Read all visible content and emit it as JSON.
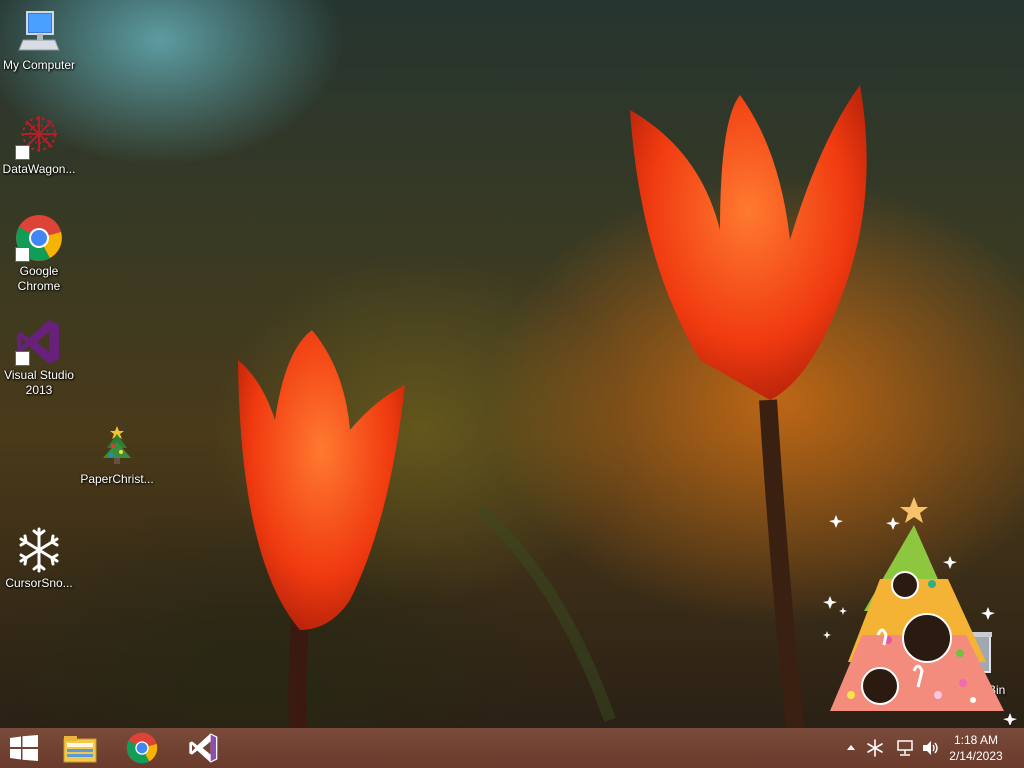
{
  "desktop": {
    "icons": [
      {
        "label": "My Computer",
        "icon": "computer-icon"
      },
      {
        "label": "DataWagon...",
        "icon": "snowflake-red-icon"
      },
      {
        "label": "Google Chrome",
        "icon": "chrome-icon"
      },
      {
        "label": "Visual Studio 2013",
        "icon": "visual-studio-icon"
      },
      {
        "label": "PaperChrist...",
        "icon": "christmas-tree-icon"
      },
      {
        "label": "CursorSno...",
        "icon": "snowflake-white-icon"
      }
    ],
    "recycle_bin_label": "Bin"
  },
  "taskbar": {
    "buttons": [
      {
        "icon": "windows-start-icon"
      },
      {
        "icon": "file-explorer-icon"
      },
      {
        "icon": "chrome-icon"
      },
      {
        "icon": "visual-studio-icon"
      }
    ],
    "tray": {
      "icons": [
        "chevron-up-icon",
        "snowflake-tray-icon",
        "network-icon",
        "volume-icon"
      ]
    },
    "clock": {
      "time": "1:18 AM",
      "date": "2/14/2023"
    }
  },
  "colors": {
    "taskbar": "#6a3a2c",
    "tulip": "#ff4a10",
    "vs_purple": "#68217a"
  }
}
